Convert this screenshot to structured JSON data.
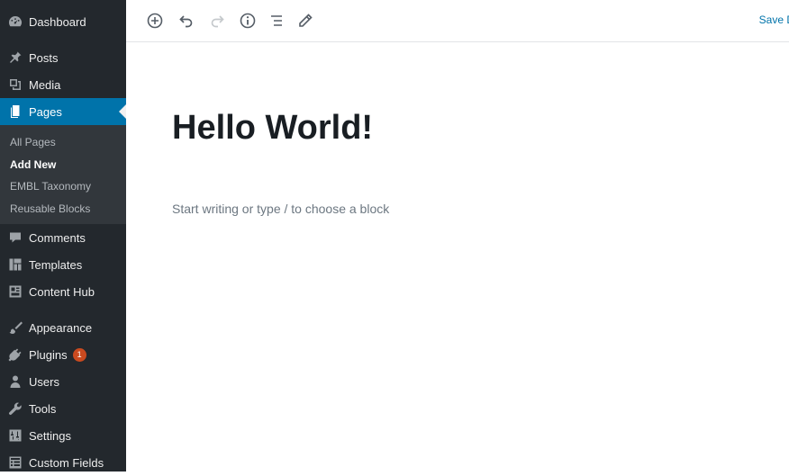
{
  "sidebar": {
    "items": [
      {
        "label": "Dashboard",
        "icon": "dashboard-icon"
      },
      {
        "label": "Posts",
        "icon": "pin-icon"
      },
      {
        "label": "Media",
        "icon": "media-icon"
      },
      {
        "label": "Pages",
        "icon": "pages-icon",
        "active": true
      },
      {
        "label": "Comments",
        "icon": "comment-icon"
      },
      {
        "label": "Templates",
        "icon": "templates-icon"
      },
      {
        "label": "Content Hub",
        "icon": "content-hub-icon"
      },
      {
        "label": "Appearance",
        "icon": "paintbrush-icon"
      },
      {
        "label": "Plugins",
        "icon": "plugin-icon",
        "badge": "1"
      },
      {
        "label": "Users",
        "icon": "user-icon"
      },
      {
        "label": "Tools",
        "icon": "wrench-icon"
      },
      {
        "label": "Settings",
        "icon": "settings-icon"
      },
      {
        "label": "Custom Fields",
        "icon": "custom-fields-icon"
      }
    ],
    "submenu": [
      {
        "label": "All Pages"
      },
      {
        "label": "Add New",
        "current": true
      },
      {
        "label": "EMBL Taxonomy"
      },
      {
        "label": "Reusable Blocks"
      }
    ],
    "colors": {
      "background": "#23282d",
      "active": "#0073aa",
      "submenu": "#32373c",
      "badge": "#ca4a1f"
    }
  },
  "toolbar": {
    "buttons": [
      "add-block-icon",
      "undo-icon",
      "redo-icon",
      "info-icon",
      "outline-icon",
      "edit-icon"
    ],
    "save_label": "Save D"
  },
  "editor": {
    "title": "Hello World!",
    "placeholder": "Start writing or type / to choose a block"
  }
}
